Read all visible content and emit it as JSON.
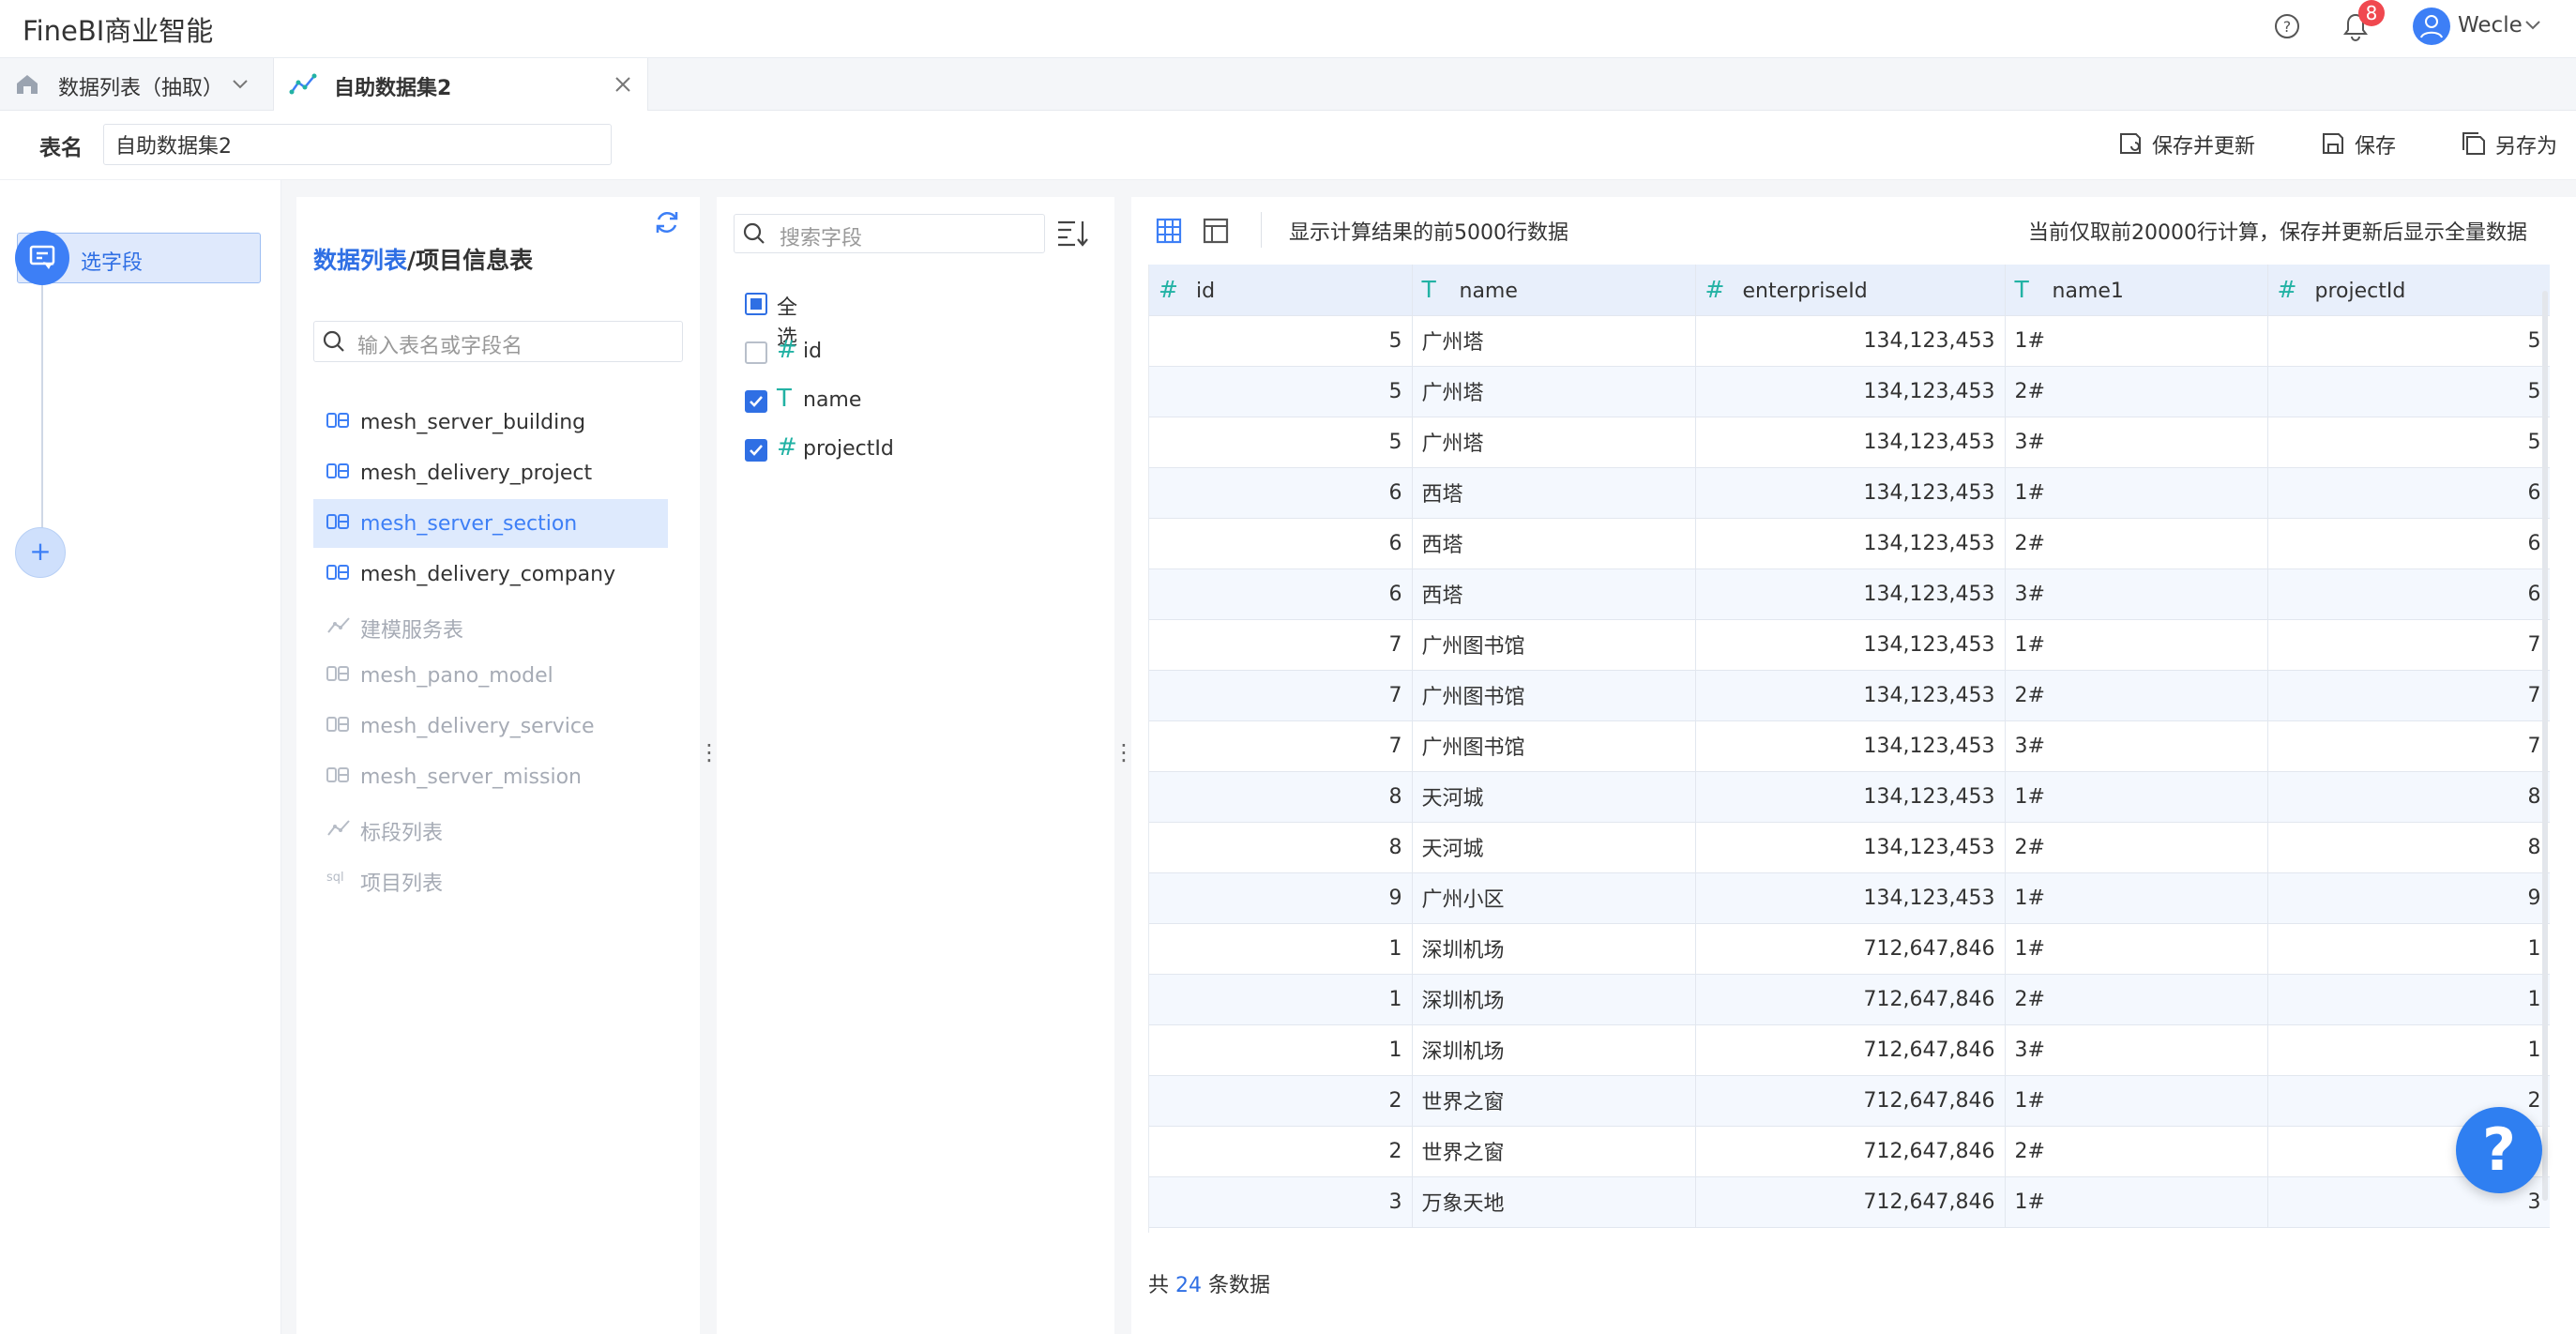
{
  "app": {
    "title": "FineBI商业智能",
    "notification_count": "8",
    "username": "Wecle"
  },
  "tabs": [
    {
      "label": "数据列表（抽取）",
      "icon": "home-icon"
    },
    {
      "label": "自助数据集2",
      "icon": "dataset-icon"
    }
  ],
  "namebar": {
    "label": "表名",
    "value": "自助数据集2"
  },
  "actions": {
    "save_update": "保存并更新",
    "save": "保存",
    "save_as": "另存为"
  },
  "steps": [
    {
      "label": "选字段"
    }
  ],
  "tables_panel": {
    "title_link": "数据列表",
    "title_rest": "/项目信息表",
    "search_placeholder": "输入表名或字段名",
    "items": [
      {
        "label": "mesh_server_building",
        "icon": "db-icon",
        "state": "normal"
      },
      {
        "label": "mesh_delivery_project",
        "icon": "db-icon",
        "state": "normal"
      },
      {
        "label": "mesh_server_section",
        "icon": "db-icon",
        "state": "selected"
      },
      {
        "label": "mesh_delivery_company",
        "icon": "db-icon",
        "state": "normal"
      },
      {
        "label": "建模服务表",
        "icon": "dataset-icon",
        "state": "disabled"
      },
      {
        "label": "mesh_pano_model",
        "icon": "db-icon",
        "state": "disabled"
      },
      {
        "label": "mesh_delivery_service",
        "icon": "db-icon",
        "state": "disabled"
      },
      {
        "label": "mesh_server_mission",
        "icon": "db-icon",
        "state": "disabled"
      },
      {
        "label": "标段列表",
        "icon": "dataset-icon",
        "state": "disabled"
      },
      {
        "label": "项目列表",
        "icon": "sql-icon",
        "state": "disabled"
      }
    ]
  },
  "fields_panel": {
    "search_placeholder": "搜索字段",
    "select_all": "全选",
    "fields": [
      {
        "label": "id",
        "type": "#",
        "checked": false
      },
      {
        "label": "name",
        "type": "T",
        "checked": true
      },
      {
        "label": "projectId",
        "type": "#",
        "checked": true
      }
    ]
  },
  "preview": {
    "note": "显示计算结果的前5000行数据",
    "right_note": "当前仅取前20000行计算，保存并更新后显示全量数据",
    "columns": [
      {
        "type": "#",
        "name": "id"
      },
      {
        "type": "T",
        "name": "name"
      },
      {
        "type": "#",
        "name": "enterpriseId"
      },
      {
        "type": "T",
        "name": "name1"
      },
      {
        "type": "#",
        "name": "projectId"
      }
    ],
    "rows": [
      [
        "5",
        "广州塔",
        "134,123,453",
        "1#",
        "5"
      ],
      [
        "5",
        "广州塔",
        "134,123,453",
        "2#",
        "5"
      ],
      [
        "5",
        "广州塔",
        "134,123,453",
        "3#",
        "5"
      ],
      [
        "6",
        "西塔",
        "134,123,453",
        "1#",
        "6"
      ],
      [
        "6",
        "西塔",
        "134,123,453",
        "2#",
        "6"
      ],
      [
        "6",
        "西塔",
        "134,123,453",
        "3#",
        "6"
      ],
      [
        "7",
        "广州图书馆",
        "134,123,453",
        "1#",
        "7"
      ],
      [
        "7",
        "广州图书馆",
        "134,123,453",
        "2#",
        "7"
      ],
      [
        "7",
        "广州图书馆",
        "134,123,453",
        "3#",
        "7"
      ],
      [
        "8",
        "天河城",
        "134,123,453",
        "1#",
        "8"
      ],
      [
        "8",
        "天河城",
        "134,123,453",
        "2#",
        "8"
      ],
      [
        "9",
        "广州小区",
        "134,123,453",
        "1#",
        "9"
      ],
      [
        "1",
        "深圳机场",
        "712,647,846",
        "1#",
        "1"
      ],
      [
        "1",
        "深圳机场",
        "712,647,846",
        "2#",
        "1"
      ],
      [
        "1",
        "深圳机场",
        "712,647,846",
        "3#",
        "1"
      ],
      [
        "2",
        "世界之窗",
        "712,647,846",
        "1#",
        "2"
      ],
      [
        "2",
        "世界之窗",
        "712,647,846",
        "2#",
        "2"
      ],
      [
        "3",
        "万象天地",
        "712,647,846",
        "1#",
        "3"
      ]
    ],
    "footer_prefix": "共",
    "footer_count": "24",
    "footer_suffix": "条数据"
  },
  "help_fab": "?",
  "colors": {
    "accent": "#3d7ff6",
    "type_icon": "#22b2a4",
    "badge": "#f0484f"
  }
}
